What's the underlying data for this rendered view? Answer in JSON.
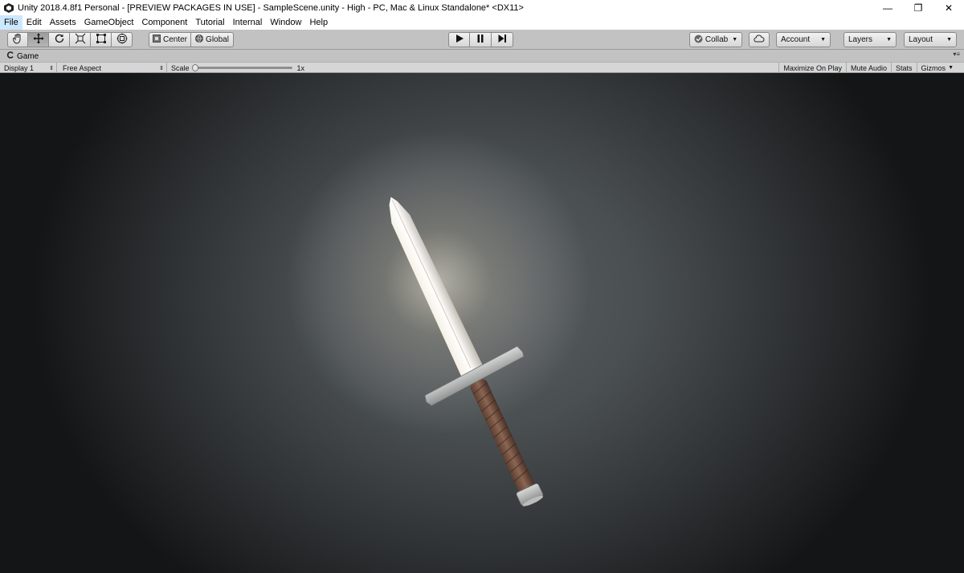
{
  "window": {
    "title": "Unity 2018.4.8f1 Personal - [PREVIEW PACKAGES IN USE] - SampleScene.unity - High - PC, Mac & Linux Standalone* <DX11>",
    "controls": {
      "minimize": "—",
      "restore": "❐",
      "close": "✕"
    }
  },
  "menu": {
    "items": [
      "File",
      "Edit",
      "Assets",
      "GameObject",
      "Component",
      "Tutorial",
      "Internal",
      "Window",
      "Help"
    ]
  },
  "toolbar": {
    "tools": [
      "hand-icon",
      "move-icon",
      "rotate-icon",
      "scale-icon",
      "rect-icon",
      "transform-icon"
    ],
    "pivot_label": "Center",
    "space_label": "Global",
    "collab_label": "Collab",
    "account_label": "Account",
    "layers_label": "Layers",
    "layout_label": "Layout"
  },
  "game_tab": {
    "label": "Game"
  },
  "game_controls": {
    "display": "Display 1",
    "aspect": "Free Aspect",
    "scale_label": "Scale",
    "scale_value": "1x",
    "maximize": "Maximize On Play",
    "mute": "Mute Audio",
    "stats": "Stats",
    "gizmos": "Gizmos"
  },
  "colors": {
    "toolbar_bg": "#c2c2c2",
    "viewport_center": "#5a5f62",
    "viewport_edge": "#141516"
  }
}
